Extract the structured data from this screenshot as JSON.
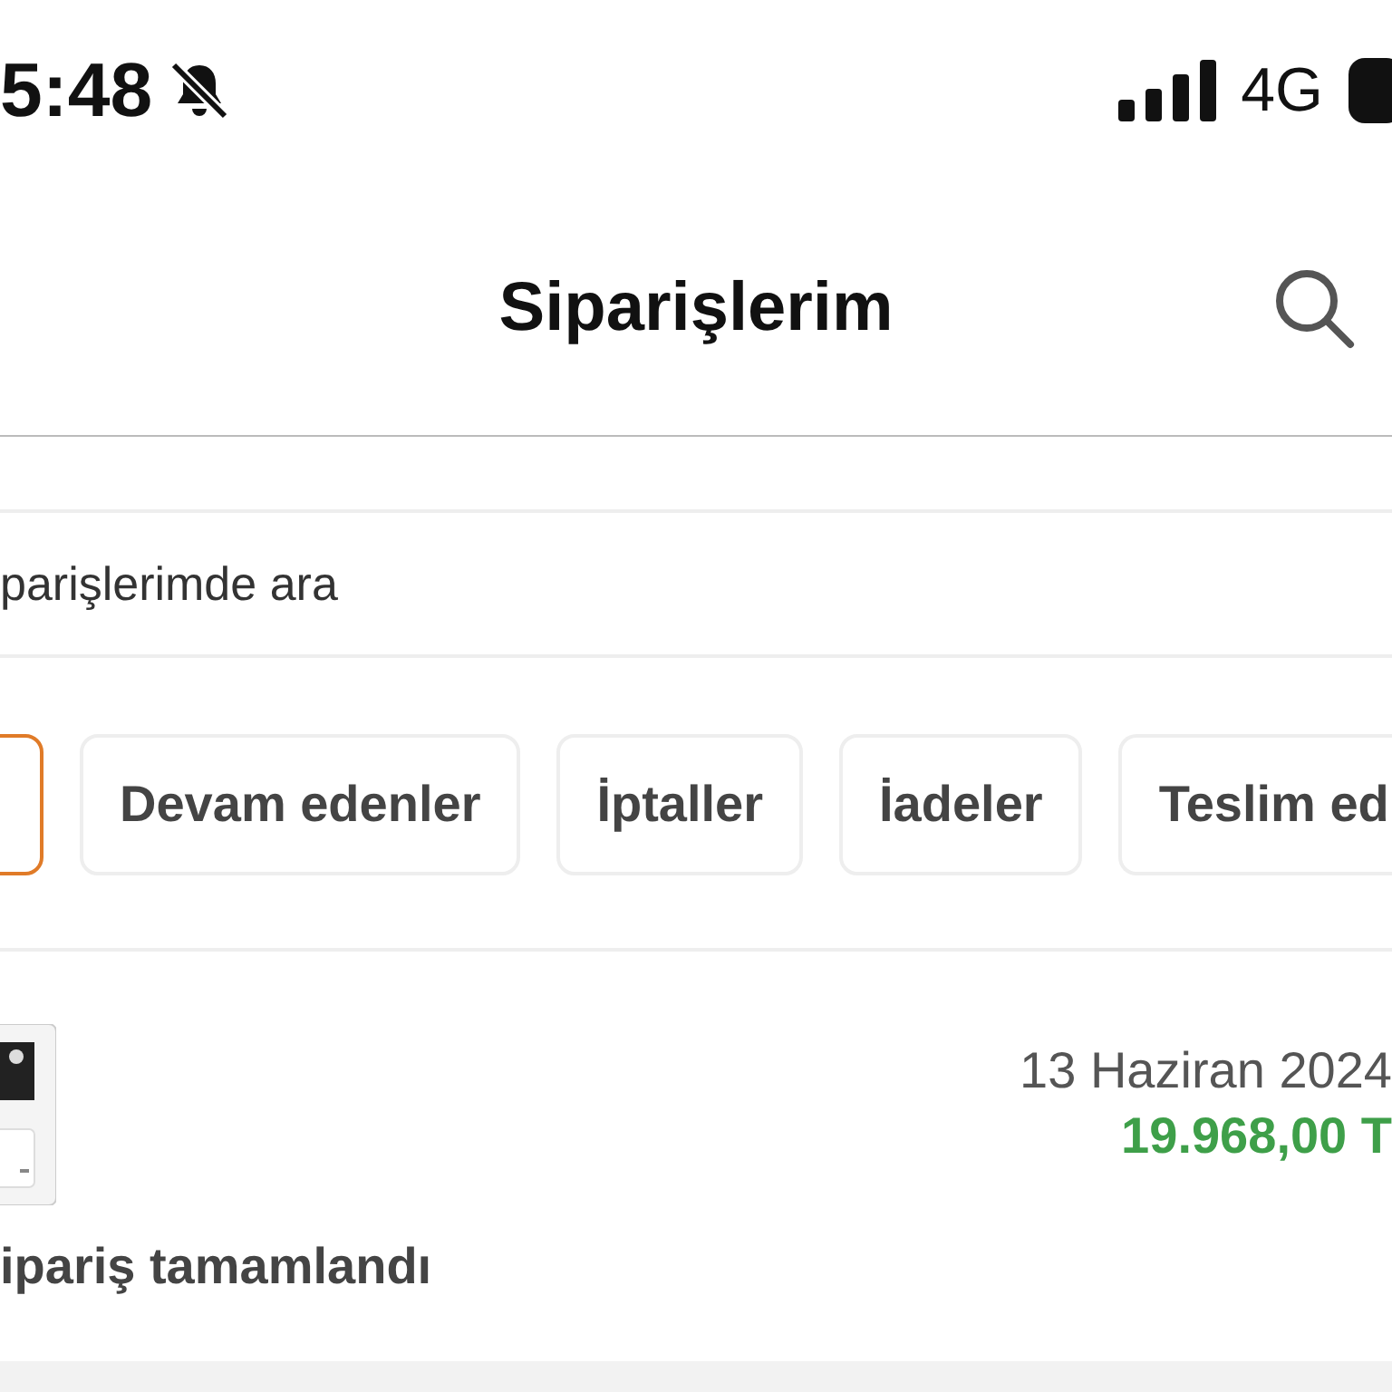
{
  "status_bar": {
    "time": "5:48",
    "network": "4G"
  },
  "header": {
    "title": "Siparişlerim"
  },
  "search": {
    "placeholder": "parişlerimde ara"
  },
  "tabs": [
    {
      "selected": true
    },
    {
      "label": "Devam edenler",
      "selected": false
    },
    {
      "label": "İptaller",
      "selected": false
    },
    {
      "label": "İadeler",
      "selected": false
    },
    {
      "label": "Teslim ed",
      "selected": false
    }
  ],
  "orders": [
    {
      "date": "13 Haziran 2024",
      "price": "19.968,00 T",
      "status": "ipariş tamamlandı"
    }
  ]
}
